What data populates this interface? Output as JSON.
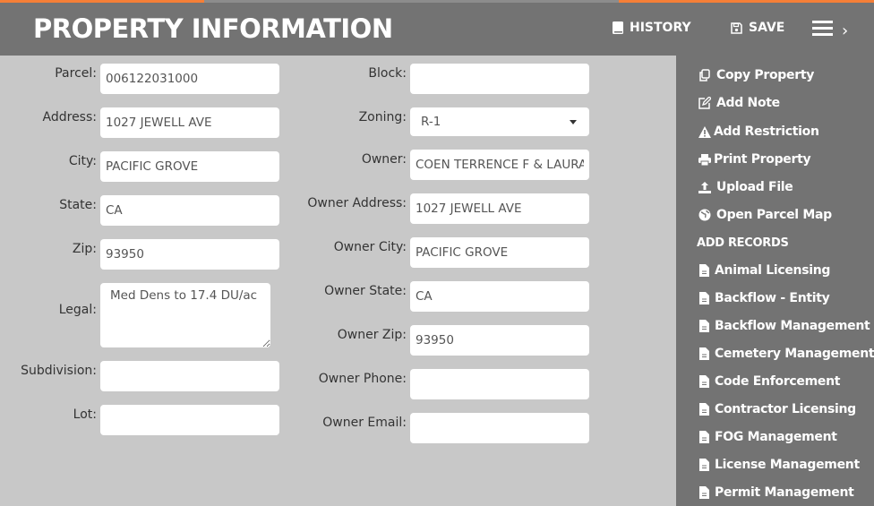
{
  "header": {
    "title": "PROPERTY INFORMATION",
    "history_label": "HISTORY",
    "save_label": "SAVE"
  },
  "colors": {
    "accent": "#f57f37",
    "header_bg": "#737373",
    "page_bg": "#c8c8c8"
  },
  "sidebar": {
    "actions": [
      {
        "label": "Copy Property",
        "icon": "copy-icon"
      },
      {
        "label": "Add Note",
        "icon": "edit-icon"
      },
      {
        "label": "Add Restriction",
        "icon": "warning-icon"
      },
      {
        "label": "Print Property",
        "icon": "print-icon"
      },
      {
        "label": "Upload File",
        "icon": "upload-icon"
      },
      {
        "label": "Open Parcel Map",
        "icon": "globe-icon"
      }
    ],
    "records_heading": "ADD RECORDS",
    "records": [
      {
        "label": "Animal Licensing",
        "icon": "file-icon"
      },
      {
        "label": "Backflow - Entity",
        "icon": "file-icon"
      },
      {
        "label": "Backflow Management",
        "icon": "file-icon"
      },
      {
        "label": "Cemetery Management",
        "icon": "file-icon"
      },
      {
        "label": "Code Enforcement",
        "icon": "file-icon"
      },
      {
        "label": "Contractor Licensing",
        "icon": "file-icon"
      },
      {
        "label": "FOG Management",
        "icon": "file-icon"
      },
      {
        "label": "License Management",
        "icon": "file-icon"
      },
      {
        "label": "Permit Management",
        "icon": "file-icon"
      }
    ]
  },
  "form": {
    "left": [
      {
        "label": "Parcel:",
        "value": "006122031000"
      },
      {
        "label": "Address:",
        "value": "1027 JEWELL AVE"
      },
      {
        "label": "City:",
        "value": "PACIFIC GROVE"
      },
      {
        "label": "State:",
        "value": "CA"
      },
      {
        "label": "Zip:",
        "value": "93950"
      },
      {
        "label": "Legal:",
        "value": "Med Dens to 17.4 DU/ac"
      },
      {
        "label": "Subdivision:",
        "value": ""
      },
      {
        "label": "Lot:",
        "value": ""
      }
    ],
    "right": [
      {
        "label": "Block:",
        "value": ""
      },
      {
        "label": "Zoning:",
        "value": "R-1"
      },
      {
        "label": "Owner:",
        "value": "COEN TERRENCE F & LAURA"
      },
      {
        "label": "Owner Address:",
        "value": "1027 JEWELL AVE"
      },
      {
        "label": "Owner City:",
        "value": "PACIFIC GROVE"
      },
      {
        "label": "Owner State:",
        "value": "CA"
      },
      {
        "label": "Owner Zip:",
        "value": "93950"
      },
      {
        "label": "Owner Phone:",
        "value": ""
      },
      {
        "label": "Owner Email:",
        "value": ""
      }
    ]
  }
}
